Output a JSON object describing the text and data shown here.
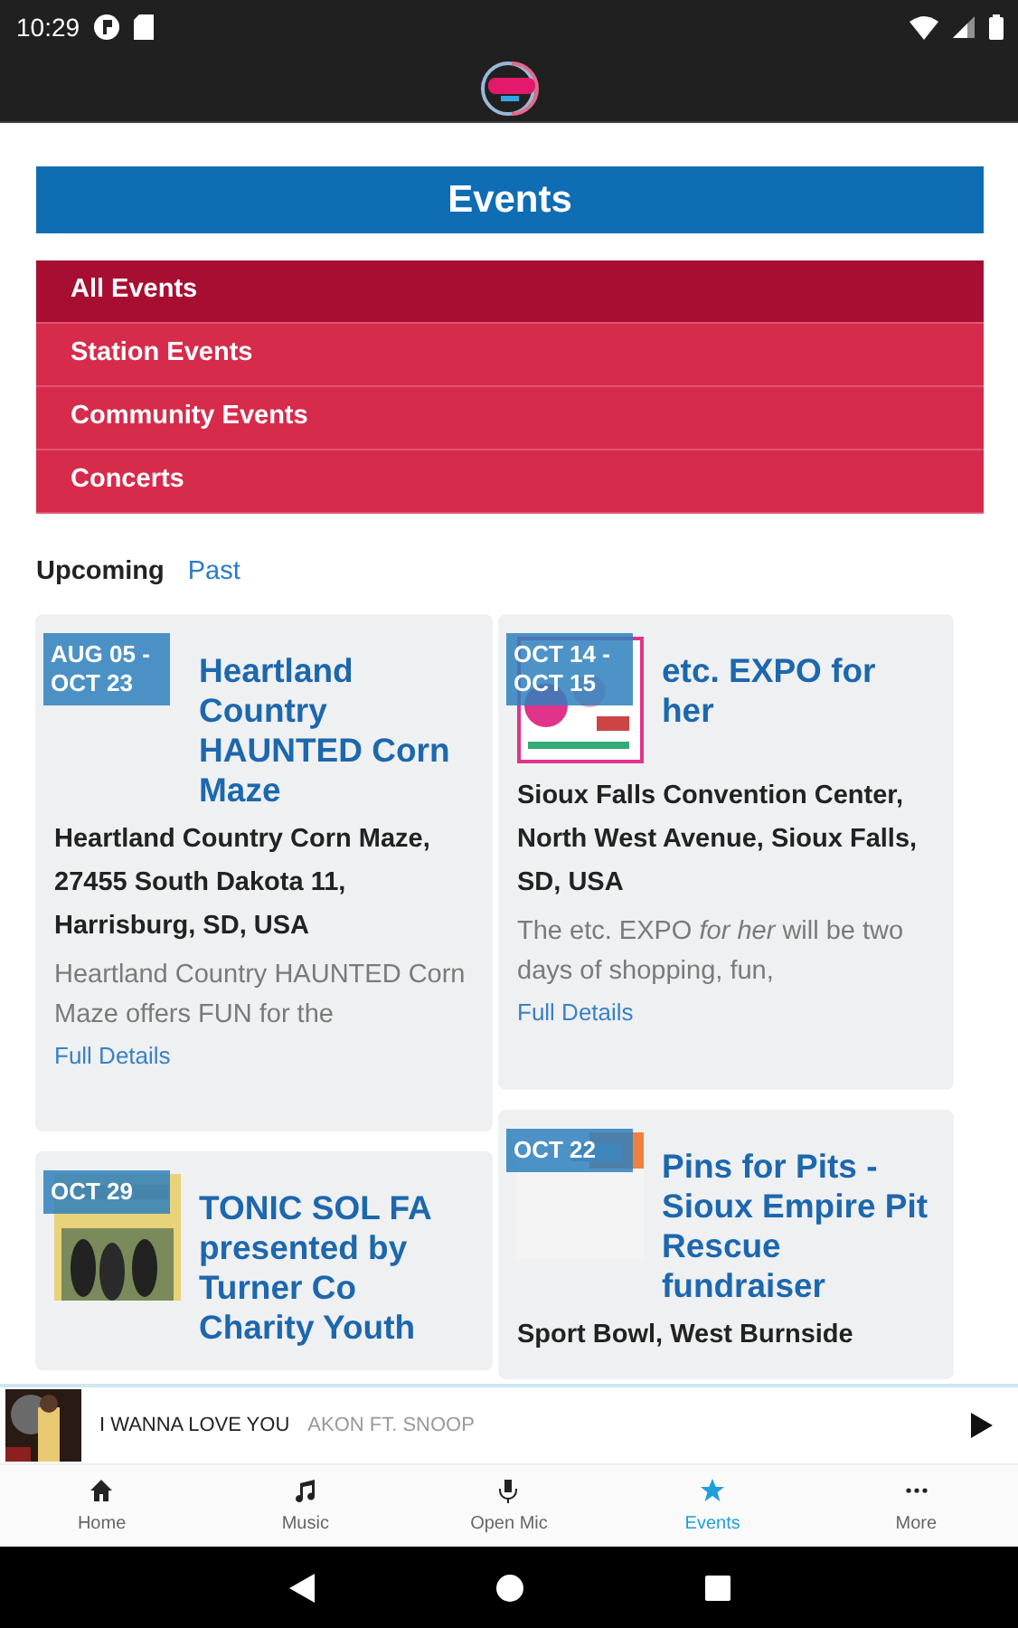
{
  "status_bar": {
    "time": "10:29"
  },
  "page": {
    "title": "Events"
  },
  "categories": [
    {
      "label": "All Events",
      "selected": true
    },
    {
      "label": "Station Events",
      "selected": false
    },
    {
      "label": "Community Events",
      "selected": false
    },
    {
      "label": "Concerts",
      "selected": false
    }
  ],
  "tabs": [
    {
      "label": "Upcoming",
      "selected": true
    },
    {
      "label": "Past",
      "selected": false
    }
  ],
  "events": [
    {
      "date": "AUG 05 - OCT 23",
      "title": "Heartland Country HAUNTED Corn Maze",
      "image": false,
      "address": "Heartland Country Corn Maze, 27455 South Dakota 11, Harrisburg, SD, USA",
      "description": "Heartland Country HAUNTED Corn Maze offers FUN for the",
      "link": "Full Details"
    },
    {
      "date": "OCT 29",
      "title": "TONIC SOL FA presented by Turner Co Charity Youth",
      "image": true
    },
    {
      "date": "OCT 14 - OCT 15",
      "title": "etc. EXPO for her",
      "image": true,
      "address": "Sioux Falls Convention Center, North West Avenue, Sioux Falls, SD, USA",
      "description": "The etc. EXPO *for her* will be two days of shopping, fun,",
      "link": "Full Details"
    },
    {
      "date": "OCT 22",
      "title": "Pins for Pits - Sioux Empire Pit Rescue fundraiser",
      "image": true,
      "address": "Sport Bowl, West Burnside"
    }
  ],
  "player": {
    "song": "I WANNA LOVE YOU",
    "artist": "AKON FT. SNOOP"
  },
  "nav": [
    {
      "label": "Home",
      "selected": false
    },
    {
      "label": "Music",
      "selected": false
    },
    {
      "label": "Open Mic",
      "selected": false
    },
    {
      "label": "Events",
      "selected": true
    },
    {
      "label": "More",
      "selected": false
    }
  ]
}
